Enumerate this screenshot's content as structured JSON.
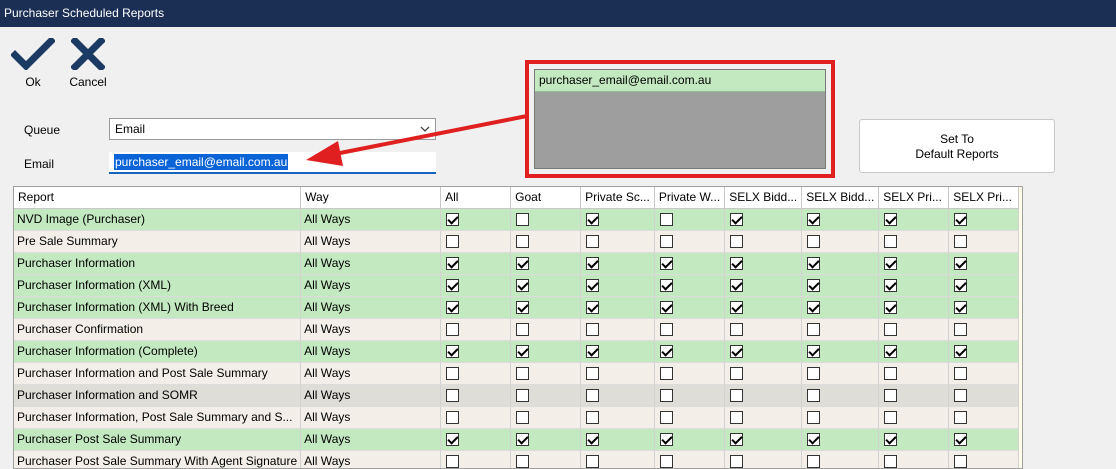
{
  "window": {
    "title": "Purchaser Scheduled Reports"
  },
  "toolbar": {
    "ok_label": "Ok",
    "cancel_label": "Cancel"
  },
  "form": {
    "queue_label": "Queue",
    "queue_value": "Email",
    "email_label": "Email",
    "email_value": "purchaser_email@email.com.au"
  },
  "callout": {
    "item": "purchaser_email@email.com.au"
  },
  "default_button": {
    "line1": "Set To",
    "line2": "Default Reports"
  },
  "colors": {
    "title_bar": "#1b2f55",
    "row_green": "#c3e9c0",
    "callout_red": "#e02020",
    "selection": "#0a64d8"
  },
  "grid": {
    "headers": [
      "Report",
      "Way",
      "All",
      "Goat",
      "Private Sc...",
      "Private W...",
      "SELX Bidd...",
      "SELX Bidd...",
      "SELX Pri...",
      "SELX Pri..."
    ],
    "rows": [
      {
        "report": "NVD Image (Purchaser)",
        "way": "All Ways",
        "style": "green",
        "checks": [
          true,
          false,
          true,
          false,
          true,
          true,
          true,
          true
        ]
      },
      {
        "report": "Pre Sale Summary",
        "way": "All Ways",
        "style": "beige",
        "checks": [
          false,
          false,
          false,
          false,
          false,
          false,
          false,
          false
        ]
      },
      {
        "report": "Purchaser Information",
        "way": "All Ways",
        "style": "green",
        "checks": [
          true,
          true,
          true,
          true,
          true,
          true,
          true,
          true
        ]
      },
      {
        "report": "Purchaser Information (XML)",
        "way": "All Ways",
        "style": "green",
        "checks": [
          true,
          true,
          true,
          true,
          true,
          true,
          true,
          true
        ]
      },
      {
        "report": "Purchaser Information (XML) With Breed",
        "way": "All Ways",
        "style": "green",
        "checks": [
          true,
          true,
          true,
          true,
          true,
          true,
          true,
          true
        ]
      },
      {
        "report": "Purchaser Confirmation",
        "way": "All Ways",
        "style": "beige",
        "checks": [
          false,
          false,
          false,
          false,
          false,
          false,
          false,
          false
        ]
      },
      {
        "report": "Purchaser Information (Complete)",
        "way": "All Ways",
        "style": "green",
        "checks": [
          true,
          true,
          true,
          true,
          true,
          true,
          true,
          true
        ]
      },
      {
        "report": "Purchaser Information and Post Sale Summary",
        "way": "All Ways",
        "style": "beige",
        "checks": [
          false,
          false,
          false,
          false,
          false,
          false,
          false,
          false
        ]
      },
      {
        "report": "Purchaser Information and SOMR",
        "way": "All Ways",
        "style": "grey",
        "checks": [
          false,
          false,
          false,
          false,
          false,
          false,
          false,
          false
        ]
      },
      {
        "report": "Purchaser Information, Post Sale Summary and S...",
        "way": "All Ways",
        "style": "beige",
        "checks": [
          false,
          false,
          false,
          false,
          false,
          false,
          false,
          false
        ]
      },
      {
        "report": "Purchaser Post Sale Summary",
        "way": "All Ways",
        "style": "green",
        "checks": [
          true,
          true,
          true,
          true,
          true,
          true,
          true,
          true
        ]
      },
      {
        "report": "Purchaser Post Sale Summary With Agent Signature",
        "way": "All Ways",
        "style": "beige",
        "checks": [
          false,
          false,
          false,
          false,
          false,
          false,
          false,
          false
        ]
      }
    ]
  }
}
